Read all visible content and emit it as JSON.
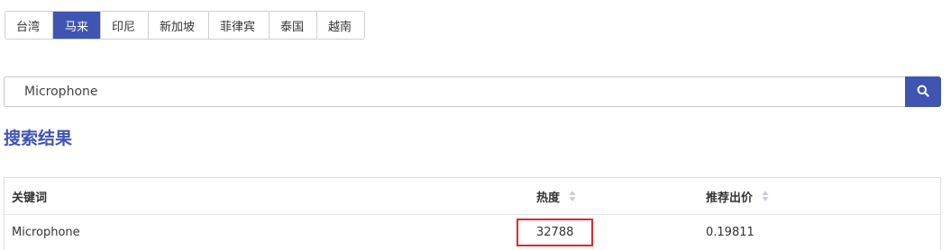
{
  "tabs": [
    {
      "label": "台湾",
      "active": false
    },
    {
      "label": "马来",
      "active": true
    },
    {
      "label": "印尼",
      "active": false
    },
    {
      "label": "新加坡",
      "active": false
    },
    {
      "label": "菲律宾",
      "active": false
    },
    {
      "label": "泰国",
      "active": false
    },
    {
      "label": "越南",
      "active": false
    }
  ],
  "search": {
    "value": "Microphone",
    "button_icon": "search-icon"
  },
  "results": {
    "title": "搜索结果",
    "columns": [
      "关键词",
      "热度",
      "推荐出价"
    ],
    "rows": [
      {
        "keyword": "Microphone",
        "heat": "32788",
        "bid": "0.19811"
      }
    ]
  },
  "colors": {
    "accent": "#4054b2",
    "highlight_box": "#e0282e"
  }
}
